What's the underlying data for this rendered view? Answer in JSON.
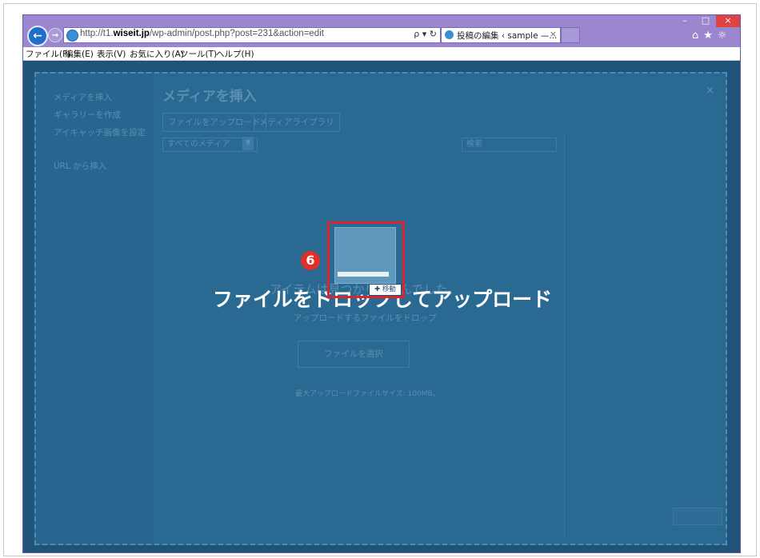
{
  "browser": {
    "url_prefix": "http://t1.",
    "url_domain": "wiseit.jp",
    "url_path": "/wp-admin/post.php?post=231&action=edit",
    "addr_tools": "ρ ▾ ↻",
    "tab_title": "投稿の編集 ‹ sample —...",
    "tab_close": "×",
    "window_min": "–",
    "window_max": "□",
    "window_close": "×",
    "toolbar_icons": "⌂★☼"
  },
  "menu": {
    "file": "ファイル(F)",
    "edit": "編集(E)",
    "view": "表示(V)",
    "favorites": "お気に入り(A)",
    "tools": "ツール(T)",
    "help": "ヘルプ(H)"
  },
  "modal": {
    "sidebar": [
      "メディアを挿入",
      "ギャラリーを作成",
      "アイキャッチ画像を設定",
      "URL から挿入"
    ],
    "title": "メディアを挿入",
    "close": "×",
    "tabs": [
      "ファイルをアップロード",
      "メディアライブラリ"
    ],
    "filter_value": "すべてのメディア",
    "search_placeholder": "検索",
    "empty_message": "アイテムは見つかりませんでした。",
    "drop_sub": "アップロードするファイルをドロップ",
    "select_button": "ファイルを選択",
    "max_size": "最大アップロードファイルサイズ: 100MB。"
  },
  "overlay": {
    "drop_text": "ファイルをドロップしてアップロード",
    "move_badge": "✚ 移動",
    "step_number": "6"
  },
  "colors": {
    "window_frame": "#8f7cc2",
    "overlay_bg": "#2a6a92",
    "highlight": "#d9252f",
    "step_badge": "#e02f29"
  }
}
